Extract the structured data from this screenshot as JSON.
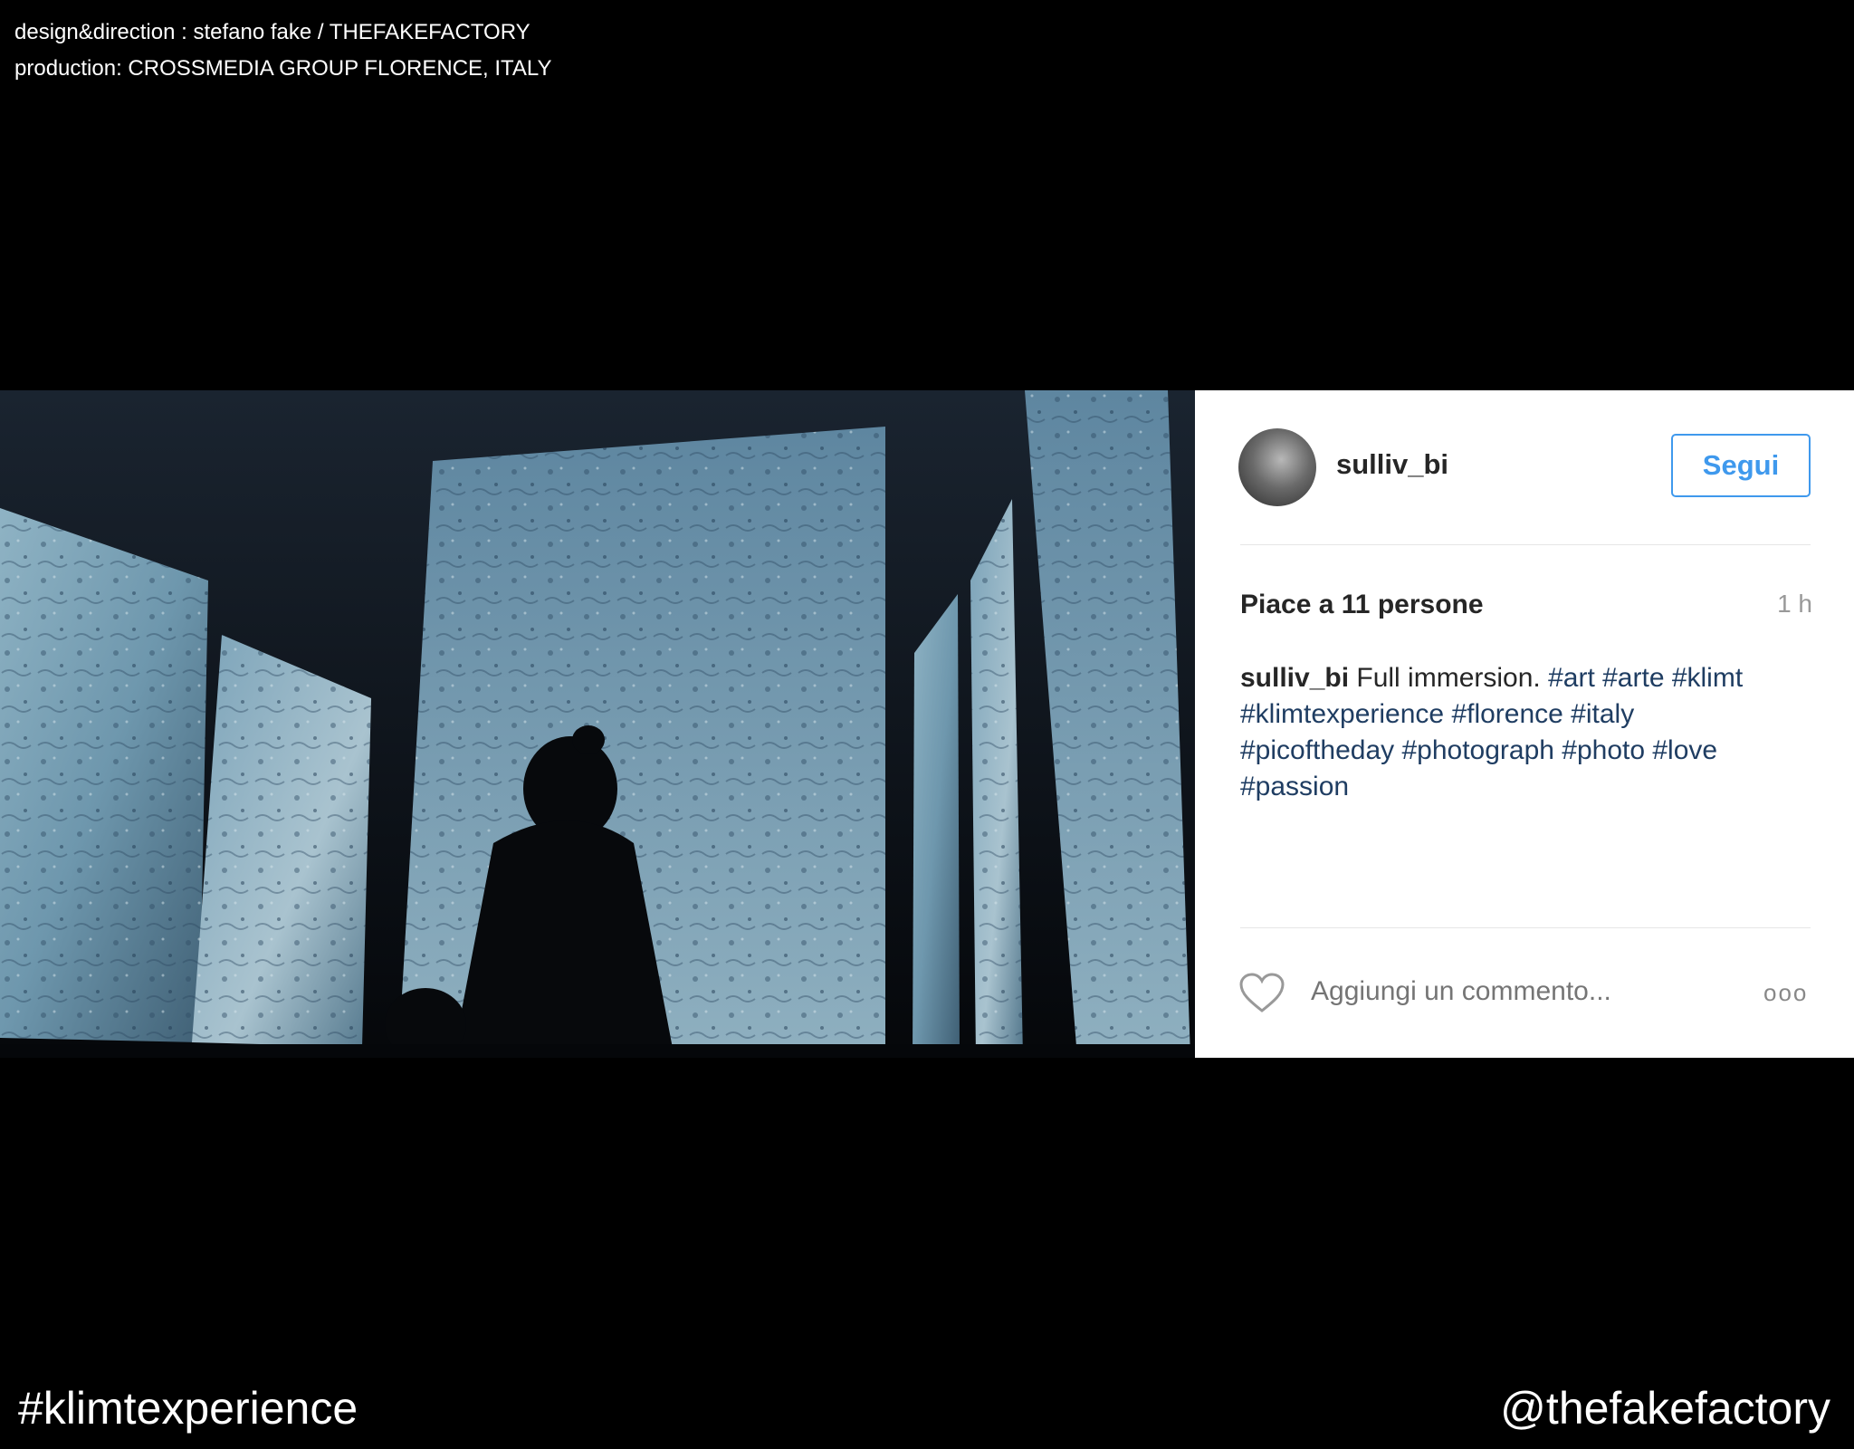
{
  "credits": {
    "line1": "design&direction : stefano fake / THEFAKEFACTORY",
    "line2": "production: CROSSMEDIA GROUP FLORENCE, ITALY"
  },
  "post": {
    "username": "sulliv_bi",
    "follow_label": "Segui",
    "likes_prefix": "Piace a ",
    "likes_count": "11",
    "likes_suffix": " persone",
    "time_ago": "1 h",
    "caption": {
      "username": "sulliv_bi",
      "text": " Full immersion. ",
      "hashtags_line1": "#art #arte #klimt",
      "hashtags_line2": "#klimtexperience #florence #italy",
      "hashtags_line3": "#picoftheday #photograph #photo #love",
      "hashtags_line4": "#passion"
    },
    "comment_placeholder": "Aggiungi un commento...",
    "more_label": "ooo",
    "icons": {
      "heart": "heart-icon",
      "more": "more-options-icon"
    }
  },
  "footer": {
    "hashtag": "#klimtexperience",
    "handle": "@thefakefactory"
  },
  "colors": {
    "follow_blue": "#3f99ed",
    "hashtag_blue": "#1f3d62",
    "background": "#000000"
  }
}
